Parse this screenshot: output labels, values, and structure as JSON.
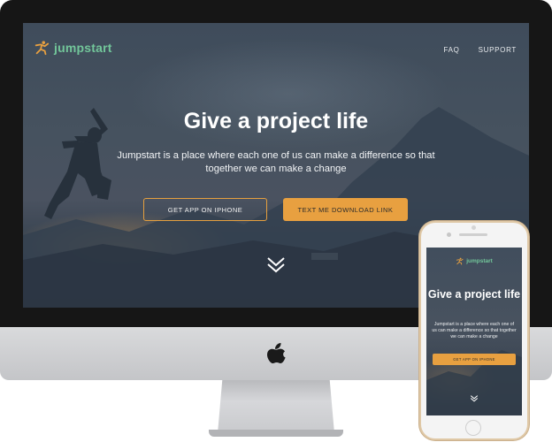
{
  "desktop": {
    "brand": {
      "name": "jumpstart",
      "icon": "jumping-figure-icon",
      "color": "#72c69a"
    },
    "nav": [
      {
        "label": "FAQ"
      },
      {
        "label": "SUPPORT"
      }
    ],
    "hero": {
      "title": "Give a project life",
      "description": "Jumpstart is a place where each one of us can make a difference so that together we can make a change",
      "button_outline": "GET APP ON IPHONE",
      "button_solid": "TEXT ME DOWNLOAD LINK",
      "scroll_icon": "double-chevron-down-icon"
    }
  },
  "mobile": {
    "brand": {
      "name": "jumpstart"
    },
    "hero": {
      "title": "Give a project life",
      "description": "Jumpstart is a place where each one of us can make a difference so that together we can make a change",
      "button": "GET APP ON IPHONE"
    }
  },
  "colors": {
    "accent": "#e8a040",
    "brand_green": "#72c69a",
    "hero_overlay": "#3f4c5b",
    "bezel": "#161616"
  }
}
